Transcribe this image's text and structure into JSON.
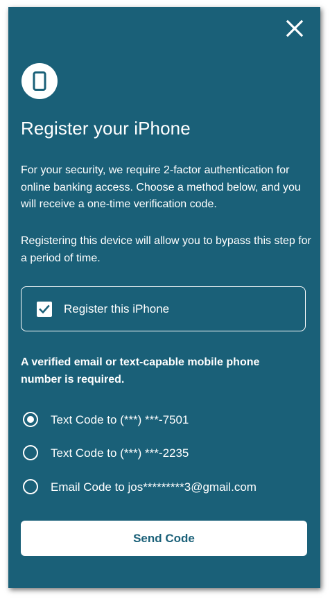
{
  "dialog": {
    "title": "Register your iPhone",
    "intro": "For your security, we require 2-factor authentication for online banking access. Choose a method below, and you will receive a one-time verification code.",
    "register_note": "Registering this device will allow you to bypass this step for a period of time.",
    "register_checkbox": {
      "label": "Register this iPhone",
      "checked": true
    },
    "requirement": "A verified email or text-capable mobile phone number is required.",
    "options": [
      {
        "label": "Text Code to (***) ***-7501",
        "selected": true
      },
      {
        "label": "Text Code to (***) ***-2235",
        "selected": false
      },
      {
        "label": "Email Code to jos*********3@gmail.com",
        "selected": false
      }
    ],
    "send_button": "Send Code"
  },
  "icons": {
    "close": "close-icon",
    "device": "smartphone-icon",
    "check": "checkmark-icon"
  },
  "colors": {
    "background": "#1a6078",
    "foreground": "#ffffff",
    "button_text": "#1a6078"
  }
}
